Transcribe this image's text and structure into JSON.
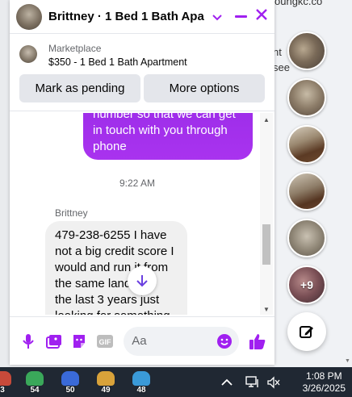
{
  "background": {
    "text_fragments": [
      "oungkc.co",
      "nt",
      "see"
    ],
    "more_photos_label": "+9"
  },
  "chat": {
    "title": "Brittney · 1 Bed 1 Bath Apa...",
    "marketplace_label": "Marketplace",
    "listing_title": "$350 - 1 Bed 1 Bath Apartment",
    "actions": {
      "pending_label": "Mark as pending",
      "more_label": "More options"
    },
    "outgoing_message_lines": [
      "number so that we can get",
      "in touch with you through",
      "phone"
    ],
    "timestamp": "9:22 AM",
    "sender_name": "Brittney",
    "incoming_message_lines": [
      "479-238-6255 I have",
      "not a big credit score I",
      "would and run it from",
      "the same land     for",
      "the last 3 years just",
      "looking for something"
    ],
    "composer_placeholder": "Aa"
  },
  "taskbar": {
    "pinned": [
      {
        "num": "3",
        "color": "#c84a3a"
      },
      {
        "num": "54",
        "color": "#3aa85a"
      },
      {
        "num": "50",
        "color": "#3a6ad8"
      },
      {
        "num": "49",
        "color": "#d8a23a"
      },
      {
        "num": "48",
        "color": "#3a9ad8"
      }
    ],
    "time": "1:08 PM",
    "date": "3/26/2025"
  },
  "colors": {
    "accent": "#a020f0",
    "outgoing_bubble": "#a22eed",
    "incoming_bubble": "#f0f0f0",
    "taskbar": "#202833"
  }
}
